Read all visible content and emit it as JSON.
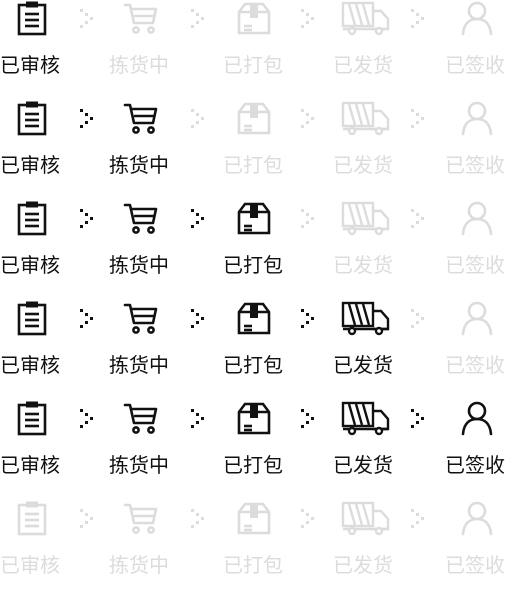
{
  "colors": {
    "done": "#111111",
    "pending": "#dcdcdc"
  },
  "steps": [
    {
      "label": "已审核",
      "icon": "clipboard-icon"
    },
    {
      "label": "拣货中",
      "icon": "shopping-cart-icon"
    },
    {
      "label": "已打包",
      "icon": "package-box-icon"
    },
    {
      "label": "已发货",
      "icon": "delivery-truck-icon"
    },
    {
      "label": "已签收",
      "icon": "user-signed-icon"
    }
  ],
  "trackers": [
    {
      "completed_steps": 1
    },
    {
      "completed_steps": 2
    },
    {
      "completed_steps": 3
    },
    {
      "completed_steps": 4
    },
    {
      "completed_steps": 5
    },
    {
      "completed_steps": 0
    }
  ]
}
